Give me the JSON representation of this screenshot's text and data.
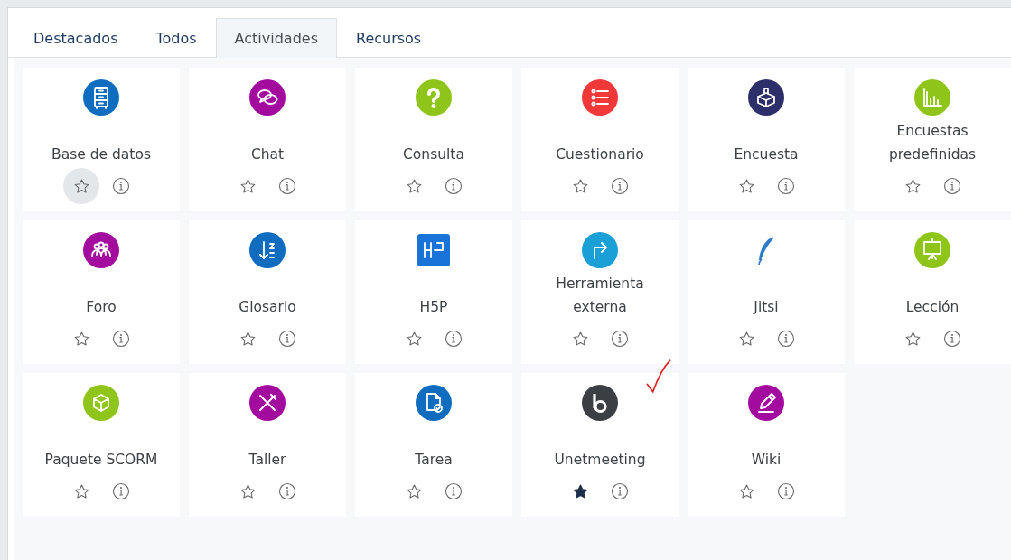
{
  "tabs": [
    {
      "label": "Destacados",
      "selected": false
    },
    {
      "label": "Todos",
      "selected": false
    },
    {
      "label": "Actividades",
      "selected": true
    },
    {
      "label": "Recursos",
      "selected": false
    }
  ],
  "items": [
    {
      "name": "Base de datos",
      "color": "#0f6cbf",
      "starred": false,
      "hovered": true
    },
    {
      "name": "Chat",
      "color": "#a30b9e",
      "starred": false,
      "hovered": false
    },
    {
      "name": "Consulta",
      "color": "#8fc518",
      "starred": false,
      "hovered": false
    },
    {
      "name": "Cuestionario",
      "color": "#f23838",
      "starred": false,
      "hovered": false
    },
    {
      "name": "Encuesta",
      "color": "#2d2f6b",
      "starred": false,
      "hovered": false
    },
    {
      "name": "Encuestas predefinidas",
      "color": "#8fc518",
      "starred": false,
      "hovered": false
    },
    {
      "name": "Foro",
      "color": "#a30b9e",
      "starred": false,
      "hovered": false
    },
    {
      "name": "Glosario",
      "color": "#0f6cbf",
      "starred": false,
      "hovered": false
    },
    {
      "name": "H5P",
      "color": "#1a73d9",
      "starred": false,
      "hovered": false
    },
    {
      "name": "Herramienta externa",
      "color": "#1a9fd6",
      "starred": false,
      "hovered": false
    },
    {
      "name": "Jitsi",
      "color": "#2f7ac9",
      "starred": false,
      "hovered": false
    },
    {
      "name": "Lección",
      "color": "#8fc518",
      "starred": false,
      "hovered": false
    },
    {
      "name": "Paquete SCORM",
      "color": "#8fc518",
      "starred": false,
      "hovered": false
    },
    {
      "name": "Taller",
      "color": "#a30b9e",
      "starred": false,
      "hovered": false
    },
    {
      "name": "Tarea",
      "color": "#0f6cbf",
      "starred": false,
      "hovered": false
    },
    {
      "name": "Unetmeeting",
      "color": "#3b3f44",
      "starred": true,
      "hovered": false
    },
    {
      "name": "Wiki",
      "color": "#a30b9e",
      "starred": false,
      "hovered": false
    }
  ]
}
